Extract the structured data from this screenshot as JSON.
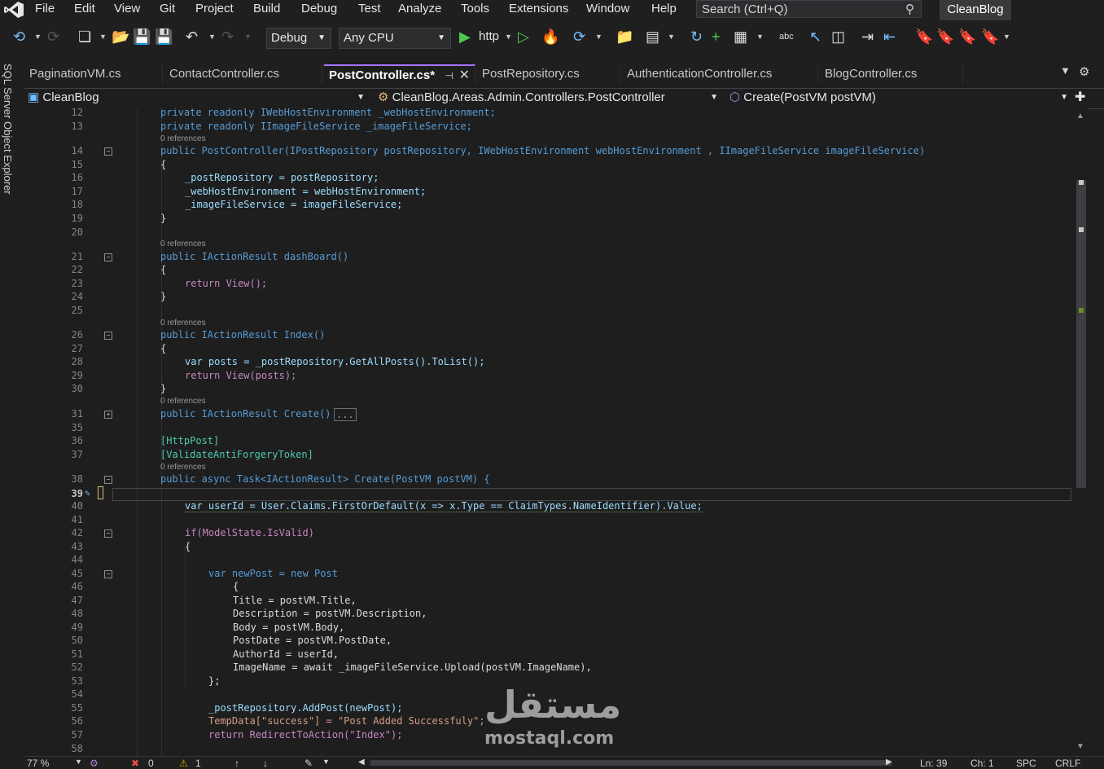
{
  "menu": {
    "items": [
      "File",
      "Edit",
      "View",
      "Git",
      "Project",
      "Build",
      "Debug",
      "Test",
      "Analyze",
      "Tools",
      "Extensions",
      "Window",
      "Help"
    ],
    "search_label": "Search (Ctrl+Q)",
    "solution": "CleanBlog"
  },
  "toolbar": {
    "configuration": "Debug",
    "platform": "Any CPU",
    "run_target": "http"
  },
  "left_panel": {
    "label": "SQL Server Object Explorer"
  },
  "tabs": [
    {
      "label": "PaginationVM.cs",
      "active": false
    },
    {
      "label": "ContactController.cs",
      "active": false
    },
    {
      "label": "PostController.cs*",
      "active": true
    },
    {
      "label": "PostRepository.cs",
      "active": false
    },
    {
      "label": "AuthenticationController.cs",
      "active": false
    },
    {
      "label": "BlogController.cs",
      "active": false
    }
  ],
  "navigation": {
    "project": "CleanBlog",
    "type": "CleanBlog.Areas.Admin.Controllers.PostController",
    "member": "Create(PostVM postVM)"
  },
  "editor": {
    "references_label": "0 references",
    "current_line": "39",
    "line_numbers": [
      "12",
      "13",
      "14",
      "15",
      "16",
      "17",
      "18",
      "19",
      "20",
      "21",
      "22",
      "23",
      "24",
      "25",
      "26",
      "27",
      "28",
      "29",
      "30",
      "31",
      "35",
      "36",
      "37",
      "38",
      "39",
      "40",
      "41",
      "42",
      "43",
      "44",
      "45",
      "46",
      "47",
      "48",
      "49",
      "50",
      "51",
      "52",
      "53",
      "54",
      "55",
      "56",
      "57",
      "58"
    ],
    "code": {
      "l12": "private readonly IWebHostEnvironment _webHostEnvironment;",
      "l13": "private readonly IImageFileService _imageFileService;",
      "l14": "public PostController(IPostRepository postRepository, IWebHostEnvironment webHostEnvironment , IImageFileService imageFileService)",
      "l15": "{",
      "l16": "_postRepository = postRepository;",
      "l17": "_webHostEnvironment = webHostEnvironment;",
      "l18": "_imageFileService = imageFileService;",
      "l19": "}",
      "l21": "public IActionResult dashBoard()",
      "l22": "{",
      "l23": "return View();",
      "l24": "}",
      "l26": "public IActionResult Index()",
      "l27": "{",
      "l28": "var posts = _postRepository.GetAllPosts().ToList();",
      "l29": "return View(posts);",
      "l30": "}",
      "l31": "public IActionResult Create()",
      "l31_collapsed": "...",
      "l36": "[HttpPost]",
      "l37": "[ValidateAntiForgeryToken]",
      "l38": "public async Task<IActionResult> Create(PostVM postVM) {",
      "l40": "var userId = User.Claims.FirstOrDefault(x => x.Type == ClaimTypes.NameIdentifier).Value;",
      "l42": "if(ModelState.IsValid)",
      "l43": "{",
      "l45": "var newPost = new Post",
      "l46": "{",
      "l47": "Title = postVM.Title,",
      "l48": "Description = postVM.Description,",
      "l49": "Body = postVM.Body,",
      "l50": "PostDate = postVM.PostDate,",
      "l51": "AuthorId = userId,",
      "l52": "ImageName = await _imageFileService.Upload(postVM.ImageName),",
      "l53": "};",
      "l55": "_postRepository.AddPost(newPost);",
      "l56": "TempData[\"success\"] = \"Post Added Successfuly\";",
      "l57": "return RedirectToAction(\"Index\");"
    }
  },
  "status": {
    "zoom": "77 %",
    "errors": "0",
    "warnings": "1",
    "line": "Ln: 39",
    "col": "Ch: 1",
    "whitespace": "SPC",
    "line_endings": "CRLF"
  },
  "watermark": {
    "arabic": "مستقل",
    "latin": "mostaql.com"
  },
  "colors": {
    "accent": "#a875ff",
    "keyword": "#569cd6",
    "type": "#4ec9b0",
    "method": "#dcdcaa",
    "string": "#d69d85",
    "parameter": "#9cdcfe"
  }
}
